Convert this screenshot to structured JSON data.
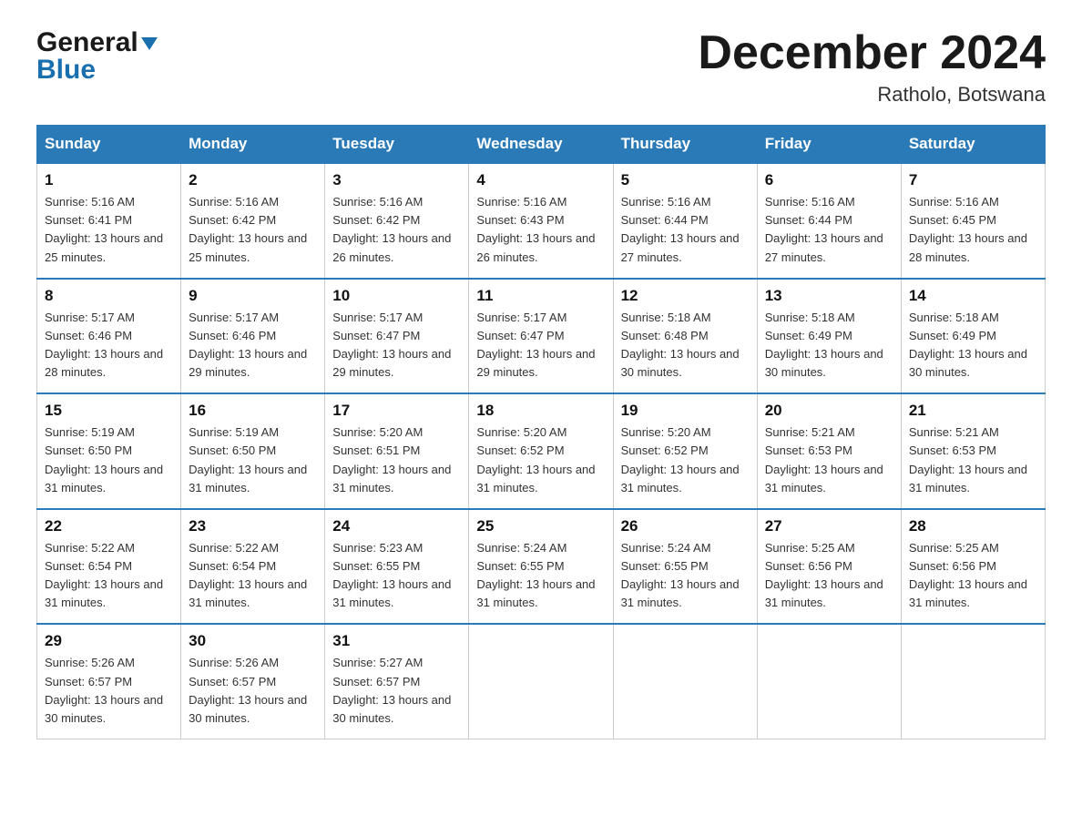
{
  "logo": {
    "line1": "General",
    "arrow": "▼",
    "line2": "Blue"
  },
  "title": "December 2024",
  "location": "Ratholo, Botswana",
  "weekdays": [
    "Sunday",
    "Monday",
    "Tuesday",
    "Wednesday",
    "Thursday",
    "Friday",
    "Saturday"
  ],
  "weeks": [
    [
      {
        "day": 1,
        "sunrise": "5:16 AM",
        "sunset": "6:41 PM",
        "daylight": "13 hours and 25 minutes."
      },
      {
        "day": 2,
        "sunrise": "5:16 AM",
        "sunset": "6:42 PM",
        "daylight": "13 hours and 25 minutes."
      },
      {
        "day": 3,
        "sunrise": "5:16 AM",
        "sunset": "6:42 PM",
        "daylight": "13 hours and 26 minutes."
      },
      {
        "day": 4,
        "sunrise": "5:16 AM",
        "sunset": "6:43 PM",
        "daylight": "13 hours and 26 minutes."
      },
      {
        "day": 5,
        "sunrise": "5:16 AM",
        "sunset": "6:44 PM",
        "daylight": "13 hours and 27 minutes."
      },
      {
        "day": 6,
        "sunrise": "5:16 AM",
        "sunset": "6:44 PM",
        "daylight": "13 hours and 27 minutes."
      },
      {
        "day": 7,
        "sunrise": "5:16 AM",
        "sunset": "6:45 PM",
        "daylight": "13 hours and 28 minutes."
      }
    ],
    [
      {
        "day": 8,
        "sunrise": "5:17 AM",
        "sunset": "6:46 PM",
        "daylight": "13 hours and 28 minutes."
      },
      {
        "day": 9,
        "sunrise": "5:17 AM",
        "sunset": "6:46 PM",
        "daylight": "13 hours and 29 minutes."
      },
      {
        "day": 10,
        "sunrise": "5:17 AM",
        "sunset": "6:47 PM",
        "daylight": "13 hours and 29 minutes."
      },
      {
        "day": 11,
        "sunrise": "5:17 AM",
        "sunset": "6:47 PM",
        "daylight": "13 hours and 29 minutes."
      },
      {
        "day": 12,
        "sunrise": "5:18 AM",
        "sunset": "6:48 PM",
        "daylight": "13 hours and 30 minutes."
      },
      {
        "day": 13,
        "sunrise": "5:18 AM",
        "sunset": "6:49 PM",
        "daylight": "13 hours and 30 minutes."
      },
      {
        "day": 14,
        "sunrise": "5:18 AM",
        "sunset": "6:49 PM",
        "daylight": "13 hours and 30 minutes."
      }
    ],
    [
      {
        "day": 15,
        "sunrise": "5:19 AM",
        "sunset": "6:50 PM",
        "daylight": "13 hours and 31 minutes."
      },
      {
        "day": 16,
        "sunrise": "5:19 AM",
        "sunset": "6:50 PM",
        "daylight": "13 hours and 31 minutes."
      },
      {
        "day": 17,
        "sunrise": "5:20 AM",
        "sunset": "6:51 PM",
        "daylight": "13 hours and 31 minutes."
      },
      {
        "day": 18,
        "sunrise": "5:20 AM",
        "sunset": "6:52 PM",
        "daylight": "13 hours and 31 minutes."
      },
      {
        "day": 19,
        "sunrise": "5:20 AM",
        "sunset": "6:52 PM",
        "daylight": "13 hours and 31 minutes."
      },
      {
        "day": 20,
        "sunrise": "5:21 AM",
        "sunset": "6:53 PM",
        "daylight": "13 hours and 31 minutes."
      },
      {
        "day": 21,
        "sunrise": "5:21 AM",
        "sunset": "6:53 PM",
        "daylight": "13 hours and 31 minutes."
      }
    ],
    [
      {
        "day": 22,
        "sunrise": "5:22 AM",
        "sunset": "6:54 PM",
        "daylight": "13 hours and 31 minutes."
      },
      {
        "day": 23,
        "sunrise": "5:22 AM",
        "sunset": "6:54 PM",
        "daylight": "13 hours and 31 minutes."
      },
      {
        "day": 24,
        "sunrise": "5:23 AM",
        "sunset": "6:55 PM",
        "daylight": "13 hours and 31 minutes."
      },
      {
        "day": 25,
        "sunrise": "5:24 AM",
        "sunset": "6:55 PM",
        "daylight": "13 hours and 31 minutes."
      },
      {
        "day": 26,
        "sunrise": "5:24 AM",
        "sunset": "6:55 PM",
        "daylight": "13 hours and 31 minutes."
      },
      {
        "day": 27,
        "sunrise": "5:25 AM",
        "sunset": "6:56 PM",
        "daylight": "13 hours and 31 minutes."
      },
      {
        "day": 28,
        "sunrise": "5:25 AM",
        "sunset": "6:56 PM",
        "daylight": "13 hours and 31 minutes."
      }
    ],
    [
      {
        "day": 29,
        "sunrise": "5:26 AM",
        "sunset": "6:57 PM",
        "daylight": "13 hours and 30 minutes."
      },
      {
        "day": 30,
        "sunrise": "5:26 AM",
        "sunset": "6:57 PM",
        "daylight": "13 hours and 30 minutes."
      },
      {
        "day": 31,
        "sunrise": "5:27 AM",
        "sunset": "6:57 PM",
        "daylight": "13 hours and 30 minutes."
      },
      null,
      null,
      null,
      null
    ]
  ]
}
